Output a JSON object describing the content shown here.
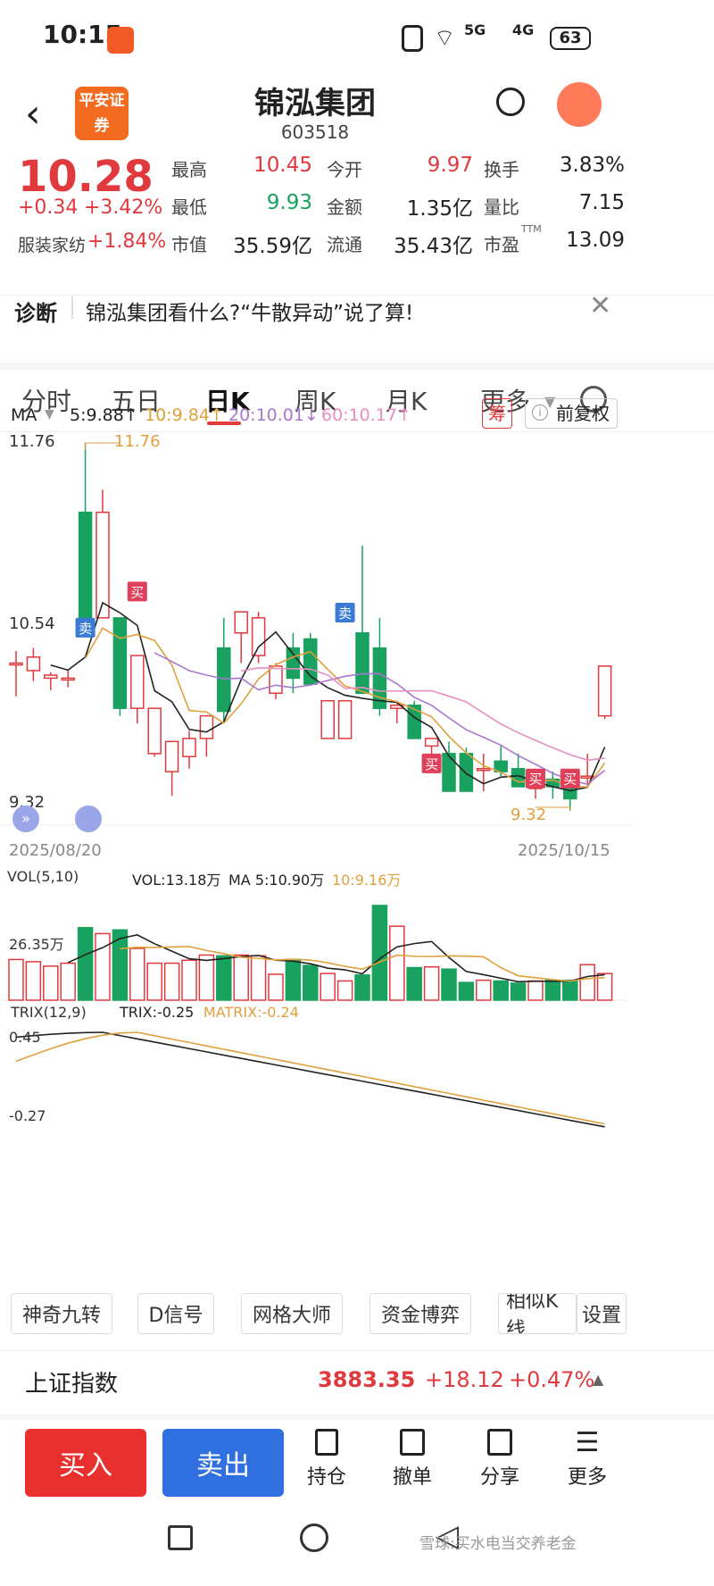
{
  "status": {
    "time": "10:15",
    "battery": "63",
    "net1": "5G",
    "net2": "4G"
  },
  "nav": {
    "title": "锦泓集团",
    "code": "603518",
    "broker_logo": "平安证券"
  },
  "quote": {
    "price": "10.28",
    "change": "+0.34",
    "change_pct": "+3.42%",
    "sector": "服装家纺",
    "sector_pct": "+1.84%",
    "cells": [
      {
        "label": "最高",
        "value": "10.45",
        "color": "red"
      },
      {
        "label": "今开",
        "value": "9.97",
        "color": "red"
      },
      {
        "label": "换手",
        "value": "3.83%",
        "color": "black"
      },
      {
        "label": "最低",
        "value": "9.93",
        "color": "green"
      },
      {
        "label": "金额",
        "value": "1.35亿",
        "color": "black"
      },
      {
        "label": "量比",
        "value": "7.15",
        "color": "black"
      },
      {
        "label": "市值",
        "value": "35.59亿",
        "color": "black"
      },
      {
        "label": "流通",
        "value": "35.43亿",
        "color": "black"
      },
      {
        "label": "市盈",
        "value": "13.09",
        "color": "black"
      }
    ],
    "pe_sup": "TTM"
  },
  "diag": {
    "label": "诊断",
    "text": "锦泓集团看什么?“牛散异动”说了算!"
  },
  "tabs": [
    "分时",
    "五日",
    "日K",
    "周K",
    "月K",
    "更多"
  ],
  "ma": {
    "label": "MA",
    "ma5": "5:9.88↑",
    "ma10": "10:9.84↑",
    "ma20": "20:10.01↓",
    "ma60": "60:10.17↑",
    "chou": "筹",
    "fuquan": "前复权"
  },
  "axis": {
    "hi": "11.76",
    "mid": "10.54",
    "lo": "9.32",
    "hi_mark": "11.76",
    "lo_mark": "9.32",
    "date_start": "2025/08/20",
    "date_end": "2025/10/15"
  },
  "signals": {
    "buy": "买",
    "sell": "卖"
  },
  "vol": {
    "label": "VOL(5,10)",
    "vol": "VOL:13.18万",
    "ma5": "MA 5:10.90万",
    "ma10": "10:9.16万",
    "axis": "26.35万"
  },
  "trix": {
    "label": "TRIX(12,9)",
    "trix": "TRIX:-0.25",
    "matrix": "MATRIX:-0.24",
    "hi": "0.45",
    "lo": "-0.27"
  },
  "tools": [
    "神奇九转",
    "D信号",
    "网格大师",
    "资金博弈",
    "相似K线",
    "设置"
  ],
  "index": {
    "name": "上证指数",
    "value": "3883.35",
    "change": "+18.12",
    "pct": "+0.47%"
  },
  "actions": {
    "buy": "买入",
    "sell": "卖出",
    "hold": "持仓",
    "cancel": "撤单",
    "share": "分享",
    "more": "更多"
  },
  "watermark": "雪球:买水电当交养老金",
  "colors": {
    "up": "#e03a3e",
    "down": "#19a15f",
    "ma5": "#222222",
    "ma10": "#e0a03c",
    "ma20": "#a878d0",
    "ma60": "#e88ec0",
    "buy_btn": "#e8302f",
    "sell_btn": "#2f6fe0"
  },
  "chart_data": {
    "type": "candlestick",
    "candles": [
      [
        10.3,
        10.38,
        10.08,
        10.3
      ],
      [
        10.25,
        10.4,
        10.18,
        10.34
      ],
      [
        10.2,
        10.24,
        10.12,
        10.22
      ],
      [
        10.2,
        10.25,
        10.14,
        10.2
      ],
      [
        11.3,
        11.76,
        10.8,
        10.6
      ],
      [
        10.6,
        11.45,
        10.6,
        11.3
      ],
      [
        10.6,
        10.6,
        9.95,
        10.0
      ],
      [
        10.0,
        10.1,
        9.9,
        10.35
      ],
      [
        9.7,
        10.0,
        9.68,
        10.0
      ],
      [
        9.58,
        9.68,
        9.42,
        9.78
      ],
      [
        9.68,
        9.85,
        9.6,
        9.8
      ],
      [
        9.8,
        9.95,
        9.68,
        9.95
      ],
      [
        10.4,
        10.6,
        9.9,
        9.98
      ],
      [
        10.5,
        10.6,
        10.3,
        10.64
      ],
      [
        10.35,
        10.64,
        10.3,
        10.6
      ],
      [
        10.1,
        10.3,
        10.06,
        10.28
      ],
      [
        10.4,
        10.5,
        10.1,
        10.2
      ],
      [
        10.46,
        10.5,
        10.15,
        10.16
      ],
      [
        9.8,
        9.8,
        9.86,
        10.05
      ],
      [
        9.8,
        9.86,
        9.84,
        10.05
      ],
      [
        10.5,
        11.08,
        10.1,
        10.1
      ],
      [
        10.4,
        10.6,
        9.95,
        10.0
      ],
      [
        10.0,
        10.05,
        9.9,
        10.02
      ],
      [
        10.02,
        10.05,
        9.9,
        9.8
      ],
      [
        9.75,
        9.78,
        9.65,
        9.8
      ],
      [
        9.7,
        9.78,
        9.52,
        9.45
      ],
      [
        9.7,
        9.74,
        9.45,
        9.45
      ],
      [
        9.6,
        9.7,
        9.45,
        9.6
      ],
      [
        9.65,
        9.75,
        9.55,
        9.58
      ],
      [
        9.6,
        9.7,
        9.5,
        9.48
      ],
      [
        9.48,
        9.6,
        9.4,
        9.48
      ],
      [
        9.53,
        9.58,
        9.4,
        9.48
      ],
      [
        9.5,
        9.55,
        9.32,
        9.4
      ],
      [
        9.55,
        9.7,
        9.5,
        9.55
      ],
      [
        9.95,
        10.28,
        9.93,
        10.28
      ]
    ],
    "volumes": [
      5.5,
      5.2,
      4.6,
      5.0,
      9.8,
      9.0,
      9.5,
      7.0,
      5.0,
      5.0,
      5.4,
      6.1,
      6.0,
      6.1,
      6.0,
      3.5,
      5.5,
      4.7,
      3.6,
      2.6,
      3.4,
      12.8,
      10.0,
      4.4,
      4.5,
      4.2,
      2.4,
      2.7,
      2.6,
      2.3,
      2.6,
      2.7,
      2.7,
      4.8,
      3.6
    ]
  }
}
